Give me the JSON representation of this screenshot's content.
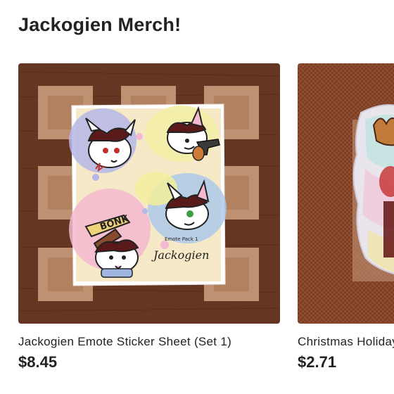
{
  "section": {
    "title": "Jackogien Merch!"
  },
  "listings": [
    {
      "title": "Jackogien Emote Sticker Sheet (Set 1)",
      "price": "$8.45",
      "sheet_caption_small": "Emote Pack 1",
      "sheet_caption_large": "Jackogien",
      "sheet_bonk_text": "BONK"
    },
    {
      "title": "Christmas Holiday Sticker",
      "price": "$2.71"
    }
  ],
  "colors": {
    "text": "#222222",
    "wood": "#6b3a24",
    "tile": "#c79a7a",
    "mat": "#8a4a2e"
  }
}
